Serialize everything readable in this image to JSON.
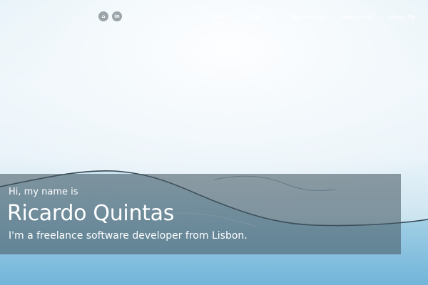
{
  "social": {
    "github_glyph": "⌂",
    "linkedin_glyph": "in",
    "icons": [
      "github-icon",
      "linkedin-icon"
    ]
  },
  "nav": {
    "items": [
      "Home",
      "What I Do",
      "My Portfolio",
      "Newsletter",
      "About Me",
      "Co"
    ]
  },
  "intro": {
    "greeting": "Hi, my name is",
    "name": "Ricardo Quintas",
    "tagline": "I'm a freelance software developer from Lisbon."
  },
  "colors": {
    "panel": "#46596480",
    "sky": "#e2f0f7",
    "water": "#8cc6e3"
  }
}
